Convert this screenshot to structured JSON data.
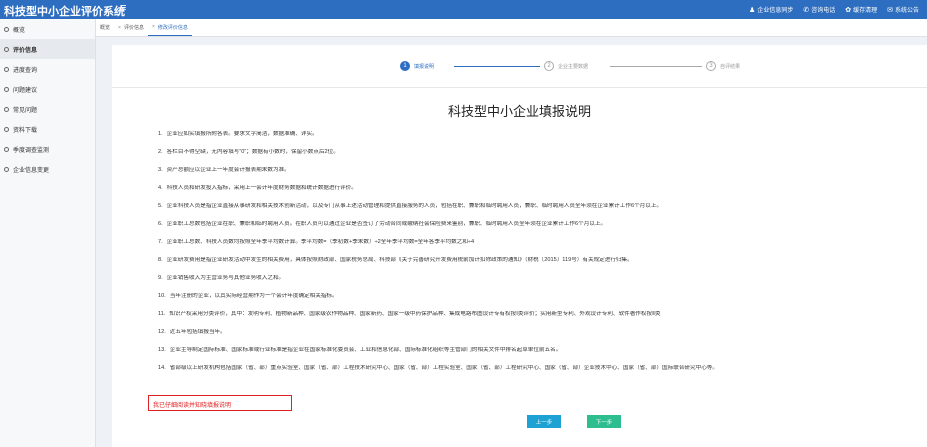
{
  "app": {
    "title": "科技型中小企业评价系统",
    "menu_icon": "≡"
  },
  "top_actions": [
    {
      "icon": "user-icon",
      "glyph": "♟",
      "label": "企业信息同步"
    },
    {
      "icon": "phone-icon",
      "glyph": "✆",
      "label": "咨询电话"
    },
    {
      "icon": "gear-icon",
      "glyph": "✿",
      "label": "缓存清理"
    },
    {
      "icon": "mail-icon",
      "glyph": "✉",
      "label": "系统公告"
    }
  ],
  "sidebar": {
    "items": [
      {
        "label": "概览"
      },
      {
        "label": "评价信息",
        "active": true
      },
      {
        "label": "进度查询"
      },
      {
        "label": "问题建议"
      },
      {
        "label": "常见问题"
      },
      {
        "label": "资料下载"
      },
      {
        "label": "季度调查监测"
      },
      {
        "label": "企业信息变更"
      }
    ]
  },
  "tabs": [
    {
      "label": "概览",
      "close": ""
    },
    {
      "label": "评价信息",
      "close": "×"
    },
    {
      "label": "修改评价信息",
      "close": "×",
      "active": true
    }
  ],
  "steps": [
    {
      "num": "1",
      "label": "填报说明",
      "done": true
    },
    {
      "num": "2",
      "label": "企业主要数据",
      "done": false
    },
    {
      "num": "3",
      "label": "自评结果",
      "done": false
    }
  ],
  "doc": {
    "title": "科技型中小企业填报说明",
    "rules": [
      {
        "n": "1.",
        "text": "企业应如实填报所附各表。要求文字简洁，数据准确、详实。"
      },
      {
        "n": "2.",
        "text": "各栏目不得空缺，无内容填写“0”；数据有小数时，保留小数点后2位。"
      },
      {
        "n": "3.",
        "text": "资产总额应以企业上一年度会计报表期末数为准。"
      },
      {
        "n": "4.",
        "text": "科技人员和研发投入指标，采用上一会计年度财务数据和统计数据进行评价。"
      },
      {
        "n": "5.",
        "text": "企业科技人员是指企业直接从事研发和相关技术创新活动，以及专门从事上述活动管理和提供直接服务的人员，包括在职、兼职和临时聘用人员，兼职、临时聘用人员全年须在企业累计工作6个月以上。"
      },
      {
        "n": "6.",
        "text": "企业职工总数包括企业在职、兼职和临时聘用人员。在职人员可以通过企业是否签订了劳动合同或缴纳社会保险费来鉴别，兼职、临时聘用人员全年须在企业累计工作6个月以上。"
      },
      {
        "n": "7.",
        "text": "企业职工总数、科技人员数均按照全年季平均数计算。季平均数=（季初数+季末数）÷2全年季平均数=全年各季平均数之和÷4"
      },
      {
        "n": "8.",
        "text": "企业研发费用是指企业研发活动中发生的相关费用，具体按照财政部、国家税务总局、科技部《关于完善研究开发费用税前加计扣除政策的通知》（财税〔2015〕119号）有关规定进行归集。"
      },
      {
        "n": "9.",
        "text": "企业销售收入为主营业务与其他业务收入之和。"
      },
      {
        "n": "10.",
        "text": "当年注册的企业，以其实际经营期作为一个会计年度确定相关指标。"
      },
      {
        "n": "11.",
        "text": "知识产权采用分类评价，其中：发明专利、植物新品种、国家级农作物品种、国家新药、国家一级中药保护品种、集成电路布图设计专有权按Ⅰ类评价；实用新型专利、外观设计专利、软件著作权按Ⅱ类"
      },
      {
        "n": "12.",
        "text": "近五年包括填报当年。"
      },
      {
        "n": "13.",
        "text": "企业主导制定国际标准、国家标准或行业标准是指企业在国家标准化委员会、工业和信息化部、国际标准化组织等主管部门的相关文件中排名起草单位前五名。"
      },
      {
        "n": "14.",
        "text": "省部级以上研发机构包括国家（省、部）重点实验室、国家（省、部）工程技术研究中心、国家（省、部）工程实验室、国家（省、部）工程研究中心、国家（省、部）企业技术中心、国家（省、部）国际联合研究中心等。"
      }
    ],
    "confirm": "我已仔细阅读并知晓填报说明"
  },
  "buttons": {
    "prev": "上一步",
    "next": "下一步"
  }
}
